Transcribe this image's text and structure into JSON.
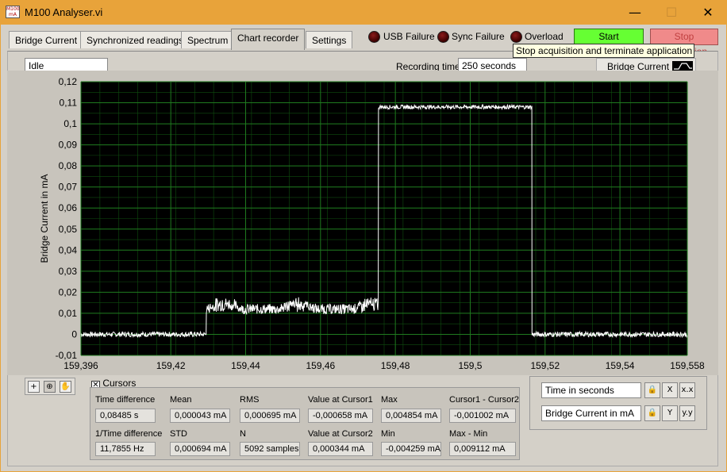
{
  "window": {
    "title": "M100 Analyser.vi",
    "icon_text": "M100 mA",
    "minimize": "—",
    "maximize": "☐",
    "close": "✕"
  },
  "tabs": [
    {
      "label": "Bridge Current",
      "active": false
    },
    {
      "label": "Synchronized readings",
      "active": false
    },
    {
      "label": "Spectrum",
      "active": false
    },
    {
      "label": "Chart recorder",
      "active": true
    },
    {
      "label": "Settings",
      "active": false
    }
  ],
  "indicators": [
    {
      "label": "USB Failure"
    },
    {
      "label": "Sync Failure"
    },
    {
      "label": "Overload"
    }
  ],
  "buttons": {
    "start": "Start Acquisition",
    "stop": "Stop Acquisition"
  },
  "tooltip": "Stop acquisition and terminate application",
  "status": "Idle",
  "recording": {
    "label": "Recording time",
    "value": "250 seconds"
  },
  "legend": {
    "label": "Bridge Current"
  },
  "chart_data": {
    "type": "line",
    "ylabel": "Bridge Current in mA",
    "xlabel": "",
    "xlim": [
      159.396,
      159.558
    ],
    "ylim": [
      -0.01,
      0.12
    ],
    "x_ticks": [
      "159,396",
      "159,42",
      "159,44",
      "159,46",
      "159,48",
      "159,5",
      "159,52",
      "159,54",
      "159,558"
    ],
    "x_tick_values": [
      159.396,
      159.42,
      159.44,
      159.46,
      159.48,
      159.5,
      159.52,
      159.54,
      159.558
    ],
    "y_ticks": [
      "0,12",
      "0,11",
      "0,1",
      "0,09",
      "0,08",
      "0,07",
      "0,06",
      "0,05",
      "0,04",
      "0,03",
      "0,02",
      "0,01",
      "0",
      "-0,01"
    ],
    "y_tick_values": [
      0.12,
      0.11,
      0.1,
      0.09,
      0.08,
      0.07,
      0.06,
      0.05,
      0.04,
      0.03,
      0.02,
      0.01,
      0,
      -0.01
    ],
    "grid": true,
    "background": "#000000",
    "grid_color": "#1f7a1f",
    "line_color": "#ffffff",
    "series": [
      {
        "segments": [
          {
            "x_start": 159.396,
            "x_end": 159.4295,
            "level": 0.0,
            "noise": 0.0015
          },
          {
            "x_start": 159.4295,
            "x_end": 159.4755,
            "level": 0.012,
            "noise": 0.003
          },
          {
            "x_start": 159.4755,
            "x_end": 159.5165,
            "level": 0.108,
            "noise": 0.0012
          },
          {
            "x_start": 159.5165,
            "x_end": 159.558,
            "level": 0.0,
            "noise": 0.0015
          }
        ]
      }
    ]
  },
  "tools": {
    "cursor": "+",
    "zoom": "⊕",
    "pan": "✋"
  },
  "cursors": {
    "checkbox_label": "Cursors",
    "checked": true,
    "measurements": [
      {
        "label": "Time difference",
        "value": "0,08485 s"
      },
      {
        "label": "Mean",
        "value": "0,000043 mA"
      },
      {
        "label": "RMS",
        "value": "0,000695 mA"
      },
      {
        "label": "Value at Cursor1",
        "value": "-0,000658 mA"
      },
      {
        "label": "Max",
        "value": "0,004854 mA"
      },
      {
        "label": "Cursor1 - Cursor2",
        "value": "-0,001002 mA"
      },
      {
        "label": "1/Time difference",
        "value": "11,7855 Hz"
      },
      {
        "label": "STD",
        "value": "0,000694 mA"
      },
      {
        "label": "N",
        "value": "5092 samples"
      },
      {
        "label": "Value at Cursor2",
        "value": "0,000344 mA"
      },
      {
        "label": "Min",
        "value": "-0,004259 mA"
      },
      {
        "label": "Max - Min",
        "value": "0,009112 mA"
      }
    ]
  },
  "axes": {
    "x_label": "Time in seconds",
    "y_label": "Bridge Current in mA"
  }
}
